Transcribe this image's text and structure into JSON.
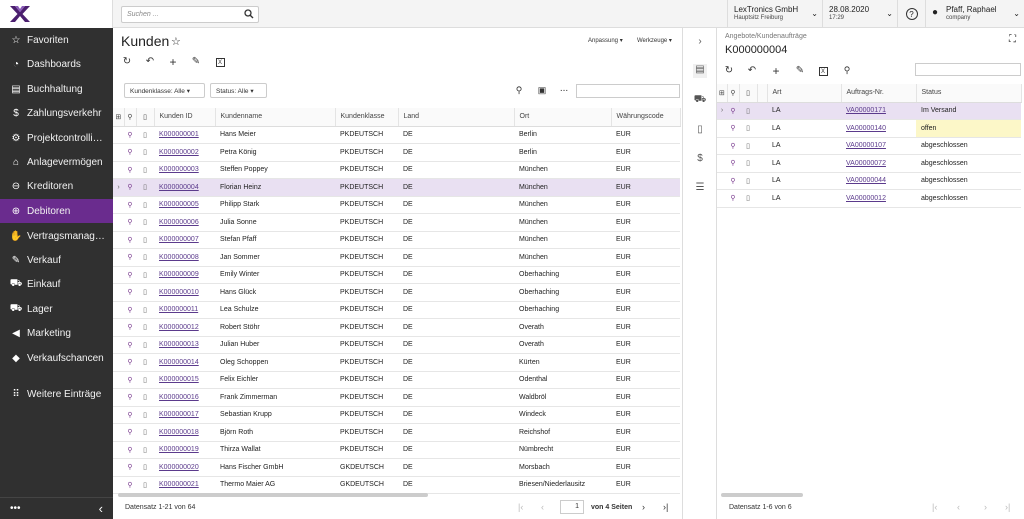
{
  "sidebar": {
    "items": [
      {
        "label": "Favoriten",
        "icon": "star-icon"
      },
      {
        "label": "Dashboards",
        "icon": "dashboard-icon"
      },
      {
        "label": "Buchhaltung",
        "icon": "book-icon"
      },
      {
        "label": "Zahlungsverkehr",
        "icon": "dollar-icon"
      },
      {
        "label": "Projektcontrolli…",
        "icon": "project-icon"
      },
      {
        "label": "Anlagevermögen",
        "icon": "factory-icon"
      },
      {
        "label": "Kreditoren",
        "icon": "minus-circle-icon"
      },
      {
        "label": "Debitoren",
        "icon": "plus-circle-icon"
      },
      {
        "label": "Vertragsmanag…",
        "icon": "handshake-icon"
      },
      {
        "label": "Verkauf",
        "icon": "edit-icon"
      },
      {
        "label": "Einkauf",
        "icon": "cart-icon"
      },
      {
        "label": "Lager",
        "icon": "truck-icon"
      },
      {
        "label": "Marketing",
        "icon": "megaphone-icon"
      },
      {
        "label": "Verkaufschancen",
        "icon": "tag-icon"
      },
      {
        "label": "Weitere Einträge",
        "icon": "grid-icon"
      }
    ],
    "active_index": 7,
    "more": "•••",
    "collapse": "‹"
  },
  "topbar": {
    "search_placeholder": "Suchen ...",
    "company": "LexTronics GmbH",
    "site": "Hauptsitz Freiburg",
    "date": "28.08.2020",
    "time": "17:29",
    "help": "?",
    "user": "Pfaff, Raphael",
    "user_sub": "company"
  },
  "left": {
    "title": "Kunden",
    "anpassung": "Anpassung",
    "werkzeuge": "Werkzeuge",
    "filter1": "Kundenklasse: Alle",
    "filter2": "Status: Alle",
    "more": "...",
    "columns": [
      "Kunden ID",
      "Kundenname",
      "Kundenklasse",
      "Land",
      "Ort",
      "Währungscode"
    ],
    "rows": [
      [
        "K000000001",
        "Hans Meier",
        "PKDEUTSCH",
        "DE",
        "Berlin",
        "EUR"
      ],
      [
        "K000000002",
        "Petra König",
        "PKDEUTSCH",
        "DE",
        "Berlin",
        "EUR"
      ],
      [
        "K000000003",
        "Steffen Poppey",
        "PKDEUTSCH",
        "DE",
        "München",
        "EUR"
      ],
      [
        "K000000004",
        "Florian Heinz",
        "PKDEUTSCH",
        "DE",
        "München",
        "EUR"
      ],
      [
        "K000000005",
        "Philipp Stark",
        "PKDEUTSCH",
        "DE",
        "München",
        "EUR"
      ],
      [
        "K000000006",
        "Julia Sonne",
        "PKDEUTSCH",
        "DE",
        "München",
        "EUR"
      ],
      [
        "K000000007",
        "Stefan Pfaff",
        "PKDEUTSCH",
        "DE",
        "München",
        "EUR"
      ],
      [
        "K000000008",
        "Jan Sommer",
        "PKDEUTSCH",
        "DE",
        "München",
        "EUR"
      ],
      [
        "K000000009",
        "Emily Winter",
        "PKDEUTSCH",
        "DE",
        "Oberhaching",
        "EUR"
      ],
      [
        "K000000010",
        "Hans Glück",
        "PKDEUTSCH",
        "DE",
        "Oberhaching",
        "EUR"
      ],
      [
        "K000000011",
        "Lea Schulze",
        "PKDEUTSCH",
        "DE",
        "Oberhaching",
        "EUR"
      ],
      [
        "K000000012",
        "Robert Stöhr",
        "PKDEUTSCH",
        "DE",
        "Overath",
        "EUR"
      ],
      [
        "K000000013",
        "Julian Huber",
        "PKDEUTSCH",
        "DE",
        "Overath",
        "EUR"
      ],
      [
        "K000000014",
        "Oleg Schoppen",
        "PKDEUTSCH",
        "DE",
        "Kürten",
        "EUR"
      ],
      [
        "K000000015",
        "Felix Eichler",
        "PKDEUTSCH",
        "DE",
        "Odenthal",
        "EUR"
      ],
      [
        "K000000016",
        "Frank Zimmerman",
        "PKDEUTSCH",
        "DE",
        "Waldbröl",
        "EUR"
      ],
      [
        "K000000017",
        "Sebastian Krupp",
        "PKDEUTSCH",
        "DE",
        "Windeck",
        "EUR"
      ],
      [
        "K000000018",
        "Björn Roth",
        "PKDEUTSCH",
        "DE",
        "Reichshof",
        "EUR"
      ],
      [
        "K000000019",
        "Thirza Wallat",
        "PKDEUTSCH",
        "DE",
        "Nümbrecht",
        "EUR"
      ],
      [
        "K000000020",
        "Hans Fischer GmbH",
        "GKDEUTSCH",
        "DE",
        "Morsbach",
        "EUR"
      ],
      [
        "K000000021",
        "Thermo Maier AG",
        "GKDEUTSCH",
        "DE",
        "Briesen/Niederlausitz",
        "EUR"
      ]
    ],
    "selected_row": 3,
    "footer": "Datensatz 1-21 von 64",
    "page": "1",
    "pages": "von 4 Seiten"
  },
  "right": {
    "breadcrumb": "Angebote/Kundenaufträge",
    "title": "K000000004",
    "columns": [
      "Art",
      "Auftrags-Nr.",
      "Status"
    ],
    "rows": [
      [
        "LA",
        "VA00000171",
        "Im Versand"
      ],
      [
        "LA",
        "VA00000140",
        "offen"
      ],
      [
        "LA",
        "VA00000107",
        "abgeschlossen"
      ],
      [
        "LA",
        "VA00000072",
        "abgeschlossen"
      ],
      [
        "LA",
        "VA00000044",
        "abgeschlossen"
      ],
      [
        "LA",
        "VA00000012",
        "abgeschlossen"
      ]
    ],
    "footer": "Datensatz 1-6 von 6"
  },
  "colors": {
    "sidebar": "#303030",
    "active": "#6a2c8e",
    "logo": "#4b1f6f",
    "link": "#5b3a8c",
    "selected": "#e9e0f2",
    "offen": "#fcf7c8"
  }
}
